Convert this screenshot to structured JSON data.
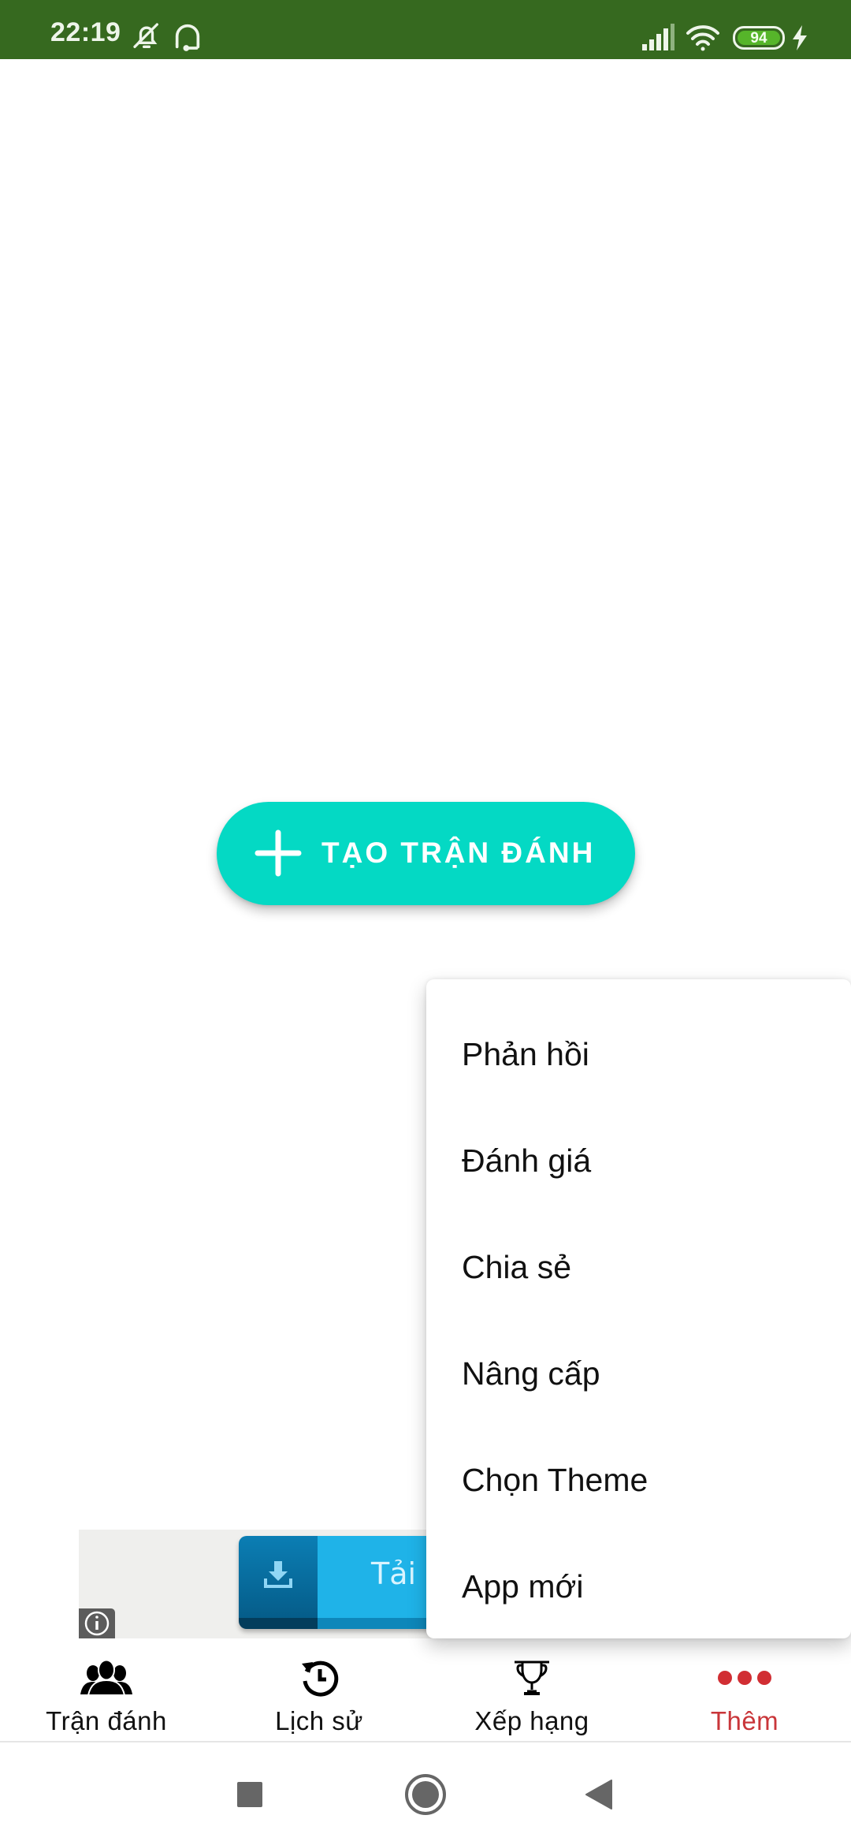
{
  "status_bar": {
    "time": "22:19",
    "icons": [
      "notifications-muted-icon",
      "headset-icon",
      "signal-icon",
      "wifi-icon",
      "battery-icon",
      "charging-icon"
    ],
    "battery_level": "94",
    "colors": {
      "background": "#36691f",
      "battery_fill": "#56b52a"
    }
  },
  "main": {
    "create_match_button": {
      "label": "TẠO TRẬN ĐÁNH",
      "icon": "plus-icon",
      "color": "#04d9c4"
    }
  },
  "ad_banner": {
    "cta_text": "Tải v",
    "icons": [
      "download-icon",
      "info-icon"
    ]
  },
  "popup_menu": {
    "items": [
      {
        "label": "Phản hồi"
      },
      {
        "label": "Đánh giá"
      },
      {
        "label": "Chia sẻ"
      },
      {
        "label": "Nâng cấp"
      },
      {
        "label": "Chọn Theme"
      },
      {
        "label": "App mới"
      }
    ]
  },
  "bottom_nav": {
    "active_color": "#c9363a",
    "items": [
      {
        "label": "Trận đánh",
        "icon": "group-icon",
        "active": false
      },
      {
        "label": "Lịch sử",
        "icon": "history-icon",
        "active": false
      },
      {
        "label": "Xếp hạng",
        "icon": "trophy-icon",
        "active": false
      },
      {
        "label": "Thêm",
        "icon": "more-dots-icon",
        "active": true
      }
    ]
  },
  "system_nav": {
    "buttons": [
      "recents-icon",
      "home-icon",
      "back-icon"
    ]
  }
}
